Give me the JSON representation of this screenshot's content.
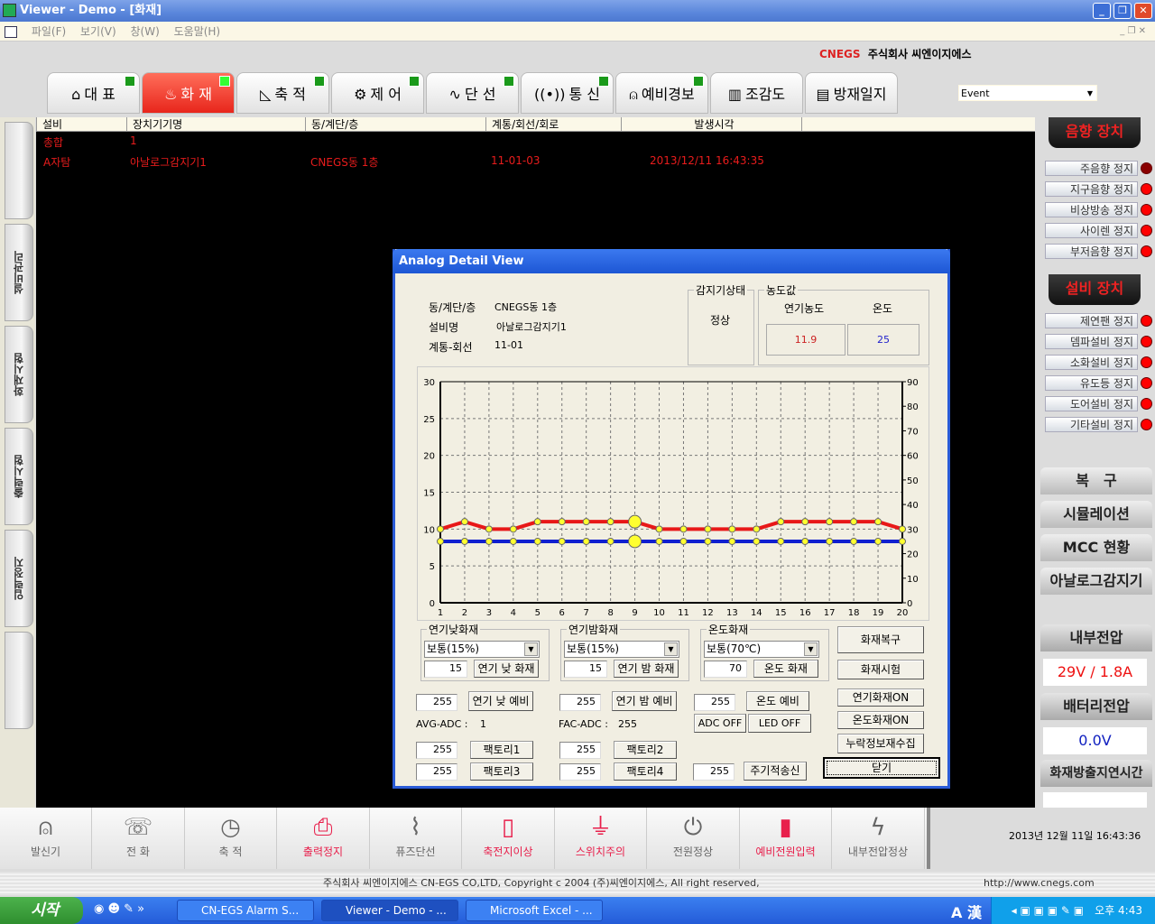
{
  "window": {
    "title": "Viewer - Demo - [화재]"
  },
  "menu": [
    "파일(F)",
    "보기(V)",
    "창(W)",
    "도움말(H)"
  ],
  "brand": {
    "logo": "CNEGS",
    "company": "주식회사 씨엔이지에스"
  },
  "tabs": [
    {
      "label": "대 표",
      "icon": "home-icon",
      "active": false
    },
    {
      "label": "화 재",
      "icon": "fire-icon",
      "active": true
    },
    {
      "label": "축 적",
      "icon": "triangle-ruler-icon",
      "active": false
    },
    {
      "label": "제 어",
      "icon": "gears-icon",
      "active": false
    },
    {
      "label": "단 선",
      "icon": "pulse-icon",
      "active": false
    },
    {
      "label": "통 신",
      "icon": "antenna-icon",
      "active": false
    },
    {
      "label": "예비경보",
      "icon": "siren-icon",
      "active": false
    },
    {
      "label": "조감도",
      "icon": "building-icon",
      "active": false
    },
    {
      "label": "방재일지",
      "icon": "document-icon",
      "active": false
    }
  ],
  "event_select": {
    "value": "Event"
  },
  "left_tabs": [
    "",
    "설비관리",
    "화재시험",
    "출력시험",
    "입력정지",
    ""
  ],
  "list": {
    "columns": [
      "설비",
      "장치기기명",
      "동/계단/층",
      "계통/회선/회로",
      "발생시각"
    ],
    "rows": [
      [
        "총합",
        "1",
        "",
        "",
        ""
      ],
      [
        "A자탐",
        "아날로그감지기1",
        "CNEGS동 1층",
        "11-01-03",
        "2013/12/11 16:43:35"
      ]
    ]
  },
  "dialog": {
    "title": "Analog Detail View",
    "info": [
      {
        "label": "동/계단/층",
        "value": "CNEGS동 1층"
      },
      {
        "label": "설비명",
        "value": "아날로그감지기1"
      },
      {
        "label": "계통-회선",
        "value": "11-01"
      }
    ],
    "sensor_state": {
      "title": "감지기상태",
      "value": "정상"
    },
    "concentration": {
      "title": "농도값",
      "smoke_label": "연기농도",
      "temp_label": "온도",
      "smoke_value": "11.9",
      "temp_value": "25"
    },
    "fire_groups": [
      {
        "title": "연기낮화재",
        "select": "보통(15%)",
        "value": "15",
        "button": "연기 낮 화재"
      },
      {
        "title": "연기밤화재",
        "select": "보통(15%)",
        "value": "15",
        "button": "연기 밤 화재"
      },
      {
        "title": "온도화재",
        "select": "보통(70℃)",
        "value": "70",
        "button": "온도 화재"
      }
    ],
    "reserve": [
      {
        "value": "255",
        "button": "연기 낮 예비"
      },
      {
        "value": "255",
        "button": "연기 밤 예비"
      },
      {
        "value": "255",
        "button": "온도 예비"
      }
    ],
    "adc_off": "ADC OFF",
    "led_off": "LED OFF",
    "avg_adc": {
      "label": "AVG-ADC :",
      "value": "1"
    },
    "fac_adc": {
      "label": "FAC-ADC :",
      "value": "255"
    },
    "factory": [
      {
        "value": "255",
        "button": "팩토리1"
      },
      {
        "value": "255",
        "button": "팩토리2"
      },
      {
        "value": "255",
        "button": "팩토리3"
      },
      {
        "value": "255",
        "button": "팩토리4"
      }
    ],
    "periodic": {
      "value": "255",
      "button": "주기적송신"
    },
    "right_buttons": [
      "화재복구",
      "화재시험",
      "연기화재ON",
      "온도화재ON",
      "누락정보재수집"
    ],
    "close": "닫기"
  },
  "chart_data": {
    "type": "line",
    "x": [
      1,
      2,
      3,
      4,
      5,
      6,
      7,
      8,
      9,
      10,
      11,
      12,
      13,
      14,
      15,
      16,
      17,
      18,
      19,
      20
    ],
    "xlim": [
      1,
      20
    ],
    "ylim_left": [
      0,
      30
    ],
    "yticks_left": [
      0,
      5,
      10,
      15,
      20,
      25,
      30
    ],
    "ylim_right": [
      0,
      90
    ],
    "yticks_right": [
      0,
      10,
      20,
      30,
      40,
      50,
      60,
      70,
      80,
      90
    ],
    "grid": true,
    "highlight_x": 9,
    "series": [
      {
        "axis": "left",
        "color": "#e81818",
        "values": [
          10,
          11,
          10,
          10,
          11,
          11,
          11,
          11,
          11,
          10,
          10,
          10,
          10,
          10,
          11,
          11,
          11,
          11,
          11,
          10
        ]
      },
      {
        "axis": "right",
        "color": "#1020d0",
        "values": [
          25,
          25,
          25,
          25,
          25,
          25,
          25,
          25,
          25,
          25,
          25,
          25,
          25,
          25,
          25,
          25,
          25,
          25,
          25,
          25
        ]
      }
    ]
  },
  "right_panel": {
    "sound_title": "음향 장치",
    "sound": [
      {
        "label": "주음향 정지",
        "led": "#8a0000"
      },
      {
        "label": "지구음향 정지",
        "led": "#ff0000"
      },
      {
        "label": "비상방송 정지",
        "led": "#ff0000"
      },
      {
        "label": "사이렌 정지",
        "led": "#ff0000"
      },
      {
        "label": "부저음향 정지",
        "led": "#ff0000"
      }
    ],
    "equip_title": "설비 장치",
    "equip": [
      {
        "label": "제연팬 정지",
        "led": "#ff0000"
      },
      {
        "label": "뎀파설비 정지",
        "led": "#ff0000"
      },
      {
        "label": "소화설비 정지",
        "led": "#ff0000"
      },
      {
        "label": "유도등 정지",
        "led": "#ff0000"
      },
      {
        "label": "도어설비 정지",
        "led": "#ff0000"
      },
      {
        "label": "기타설비 정지",
        "led": "#ff0000"
      }
    ],
    "buttons": [
      "복　구",
      "시뮬레이션",
      "MCC 현황",
      "아날로그감지기"
    ],
    "internal_voltage": {
      "label": "내부전압",
      "value": "29V / 1.8A"
    },
    "battery_voltage": {
      "label": "배터리전압",
      "value": "0.0V"
    },
    "fire_delay": {
      "label": "화재방출지연시간",
      "value": ""
    }
  },
  "status_bar": [
    {
      "label": "발신기",
      "icon": "transmitter-icon",
      "alert": false
    },
    {
      "label": "전 화",
      "icon": "phone-icon",
      "alert": false
    },
    {
      "label": "축 적",
      "icon": "clock-icon",
      "alert": false
    },
    {
      "label": "출력정지",
      "icon": "printer-stop-icon",
      "alert": true
    },
    {
      "label": "퓨즈단선",
      "icon": "fuse-pulse-icon",
      "alert": false
    },
    {
      "label": "축전지이상",
      "icon": "battery-alert-icon",
      "alert": true
    },
    {
      "label": "스위치주의",
      "icon": "plug-alert-icon",
      "alert": true
    },
    {
      "label": "전원정상",
      "icon": "power-icon",
      "alert": false
    },
    {
      "label": "예비전원입력",
      "icon": "battery-low-icon",
      "alert": true
    },
    {
      "label": "내부전압정상",
      "icon": "volt-icon",
      "alert": false
    }
  ],
  "datetime": "2013년 12월 11일 16:43:36",
  "footer": {
    "copyright": "주식회사 씨엔이지에스 CN-EGS CO,LTD, Copyright c 2004 (주)씨엔이지에스, All right reserved,",
    "url": "http://www.cnegs.com"
  },
  "taskbar": {
    "start": "시작",
    "tasks": [
      "CN-EGS Alarm S...",
      "Viewer - Demo - ...",
      "Microsoft Excel - ..."
    ],
    "ime": "A 漢",
    "clock": "오후 4:43"
  }
}
